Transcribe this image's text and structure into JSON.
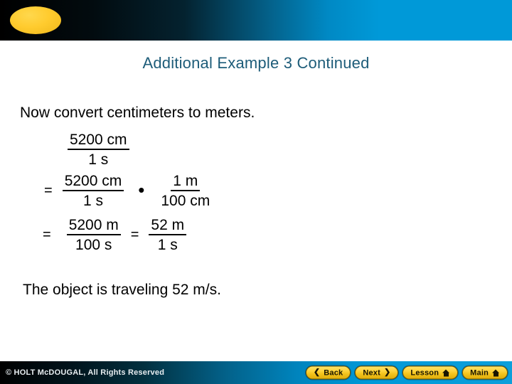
{
  "header": {
    "ellipse_icon": "yellow-ellipse-logo",
    "gradient_from": "#000000",
    "gradient_to": "#0099d8"
  },
  "slide": {
    "title": "Additional Example 3 Continued",
    "title_color": "#1d5c79",
    "intro": "Now convert centimeters to meters.",
    "conclusion": "The object is traveling 52 m/s."
  },
  "work": {
    "rows": [
      {
        "id": "row-1",
        "equals": "",
        "terms": [
          {
            "numerator": "5200 cm",
            "denominator": "1 s"
          }
        ]
      },
      {
        "id": "row-2",
        "equals": "=",
        "operator": "•",
        "terms": [
          {
            "numerator": "5200 cm",
            "denominator": "1 s"
          },
          {
            "numerator": "1 m",
            "denominator": "100 cm"
          }
        ]
      },
      {
        "id": "row-3",
        "equals": "=",
        "equals_2": "=",
        "terms": [
          {
            "numerator": "5200 m",
            "denominator": "100 s"
          },
          {
            "numerator": "52 m",
            "denominator": "1 s"
          }
        ]
      }
    ]
  },
  "footer": {
    "copyright": "© HOLT McDOUGAL, All Rights Reserved",
    "buttons": [
      {
        "label": "Back",
        "icon": "chevron-left-icon",
        "glyph": "❮"
      },
      {
        "label": "Next",
        "icon": "chevron-right-icon",
        "glyph": "❯"
      },
      {
        "label": "Lesson",
        "icon": "home-icon",
        "glyph": ""
      },
      {
        "label": "Main",
        "icon": "home-icon",
        "glyph": ""
      }
    ],
    "accent_color": "#fdd43c"
  }
}
